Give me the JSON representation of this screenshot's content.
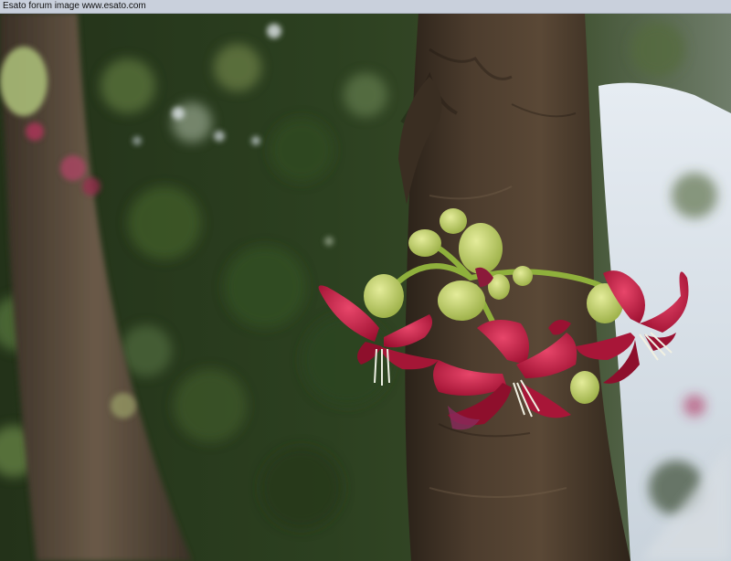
{
  "banner": {
    "text": "Esato forum image www.esato.com"
  },
  "photo": {
    "subject_icons": [
      "tree-trunk",
      "flower-cluster",
      "leaf-bokeh",
      "sky"
    ],
    "colors": {
      "banner_bg": "#c9d0dc",
      "bark": "#4a3a2c",
      "bark_dark": "#2b2219",
      "petal": "#c0183e",
      "petal_light": "#e03a5e",
      "bud": "#b9c86a",
      "stem": "#8fb03c",
      "foliage": "#3d5a26",
      "foliage_dark": "#1f2d17",
      "sky": "#d9e2ea"
    }
  }
}
